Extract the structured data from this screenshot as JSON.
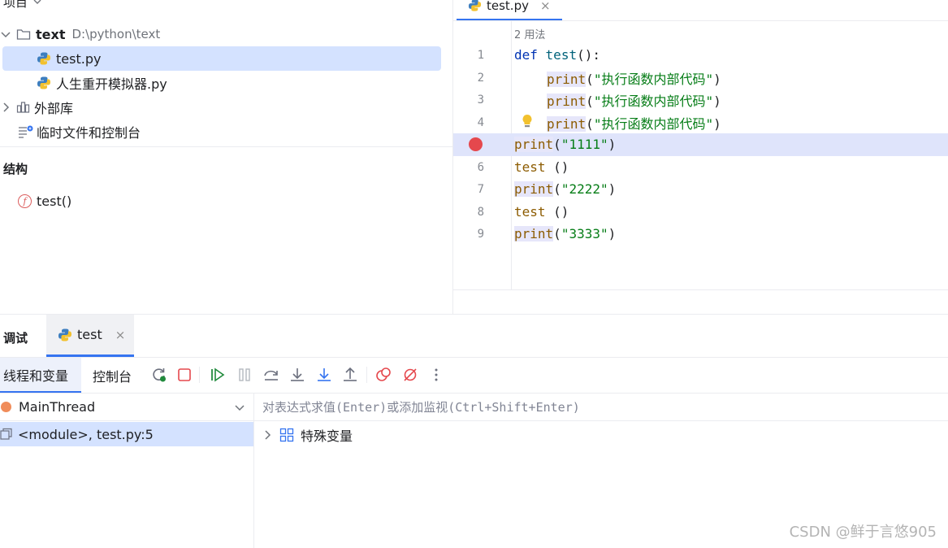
{
  "project": {
    "header_label": "项目",
    "root": {
      "name": "text",
      "path": "D:\\python\\text"
    },
    "files": [
      {
        "name": "test.py"
      },
      {
        "name": "人生重开模拟器.py"
      }
    ],
    "external_libs": "外部库",
    "scratches": "临时文件和控制台"
  },
  "structure": {
    "title": "结构",
    "items": [
      {
        "label": "test()"
      }
    ]
  },
  "editor": {
    "tab_label": "test.py",
    "usages": "2 用法",
    "breakpoint_line": 5,
    "current_line": 5,
    "lines": [
      {
        "num": "1",
        "kw": "def",
        "fn": "test",
        "rest": "():"
      },
      {
        "num": "2",
        "builtin": "print",
        "open": "(",
        "str": "\"执行函数内部代码\"",
        "close": ")"
      },
      {
        "num": "3",
        "builtin": "print",
        "open": "(",
        "str": "\"执行函数内部代码\"",
        "close": ")"
      },
      {
        "num": "4",
        "builtin": "print",
        "open": "(",
        "str": "\"执行函数内部代码\"",
        "close": ")"
      },
      {
        "num": "5",
        "builtin": "print",
        "open": "(",
        "str": "\"1111\"",
        "close": ")"
      },
      {
        "num": "6",
        "call": "test",
        "args": " ()"
      },
      {
        "num": "7",
        "builtin": "print",
        "open": "(",
        "str": "\"2222\"",
        "close": ")"
      },
      {
        "num": "8",
        "call": "test",
        "args": " ()"
      },
      {
        "num": "9",
        "builtin": "print",
        "open": "(",
        "str": "\"3333\"",
        "close": ")"
      }
    ]
  },
  "debug": {
    "title": "调试",
    "session_tab": "test",
    "subtabs": {
      "threads": "线程和变量",
      "console": "控制台"
    },
    "thread": "MainThread",
    "frame": "<module>, test.py:5",
    "eval_placeholder": "对表达式求值(Enter)或添加监视(Ctrl+Shift+Enter)",
    "special_vars": "特殊变量",
    "toolbar": [
      "rerun-icon",
      "stop-icon",
      "resume-icon",
      "pause-icon",
      "step-over-icon",
      "step-into-icon",
      "step-into-my-code-icon",
      "step-out-icon",
      "view-breakpoints-icon",
      "mute-breakpoints-icon",
      "more-icon"
    ]
  },
  "watermark": "CSDN @鲜于言悠905",
  "colors": {
    "accent": "#3574f0",
    "selection": "#d4e2ff",
    "breakpoint": "#e5484d",
    "keyword": "#0033b3",
    "string": "#067d17"
  }
}
